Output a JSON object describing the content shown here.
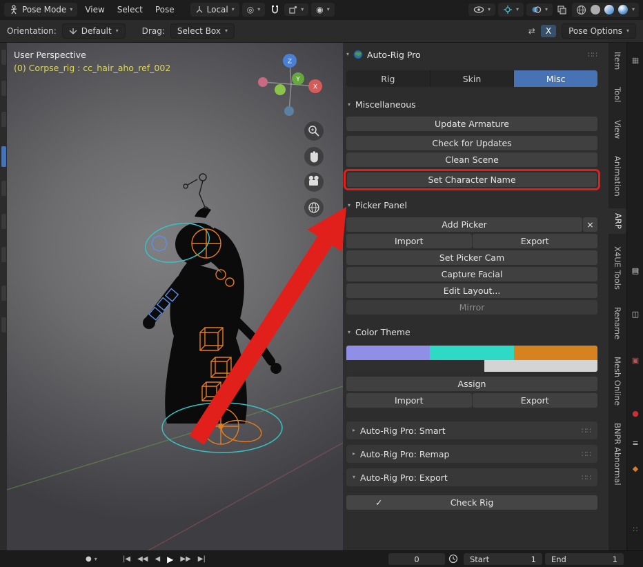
{
  "colors": {
    "accent_blue": "#4772b3",
    "highlight_red": "#e2201b",
    "swatch_lavender": "#8f8fe8",
    "swatch_turquoise": "#2ed9c5",
    "swatch_orange": "#d6821f",
    "swatch_dark": "#2f2f2f",
    "swatch_light": "#d4d4d4"
  },
  "icons": {
    "chevron_down": "▾",
    "chevron_right": "▸",
    "close": "×",
    "check": "✓",
    "grip": "∷∷",
    "record": "●",
    "pivot": "◎",
    "prop_edit": "◉",
    "mirror_axes": "⇄",
    "jump_start": "|◀",
    "prev_key": "◀◀",
    "play_back": "◀",
    "play": "▶",
    "next_key": "▶▶",
    "jump_end": "▶|"
  },
  "topbar": {
    "mode": "Pose Mode",
    "menus": [
      "View",
      "Select",
      "Pose"
    ],
    "orientation": "Local"
  },
  "toolbar": {
    "orientation_label": "Orientation:",
    "orientation_value": "Default",
    "drag_label": "Drag:",
    "drag_value": "Select Box",
    "mirror_x": "X",
    "pose_options": "Pose Options"
  },
  "viewport": {
    "view_label": "User Perspective",
    "object_label": "(0) Corpse_rig : cc_hair_aho_ref_002",
    "axis": {
      "x": "X",
      "y": "Y",
      "z": "Z"
    }
  },
  "panel": {
    "title": "Auto-Rig Pro",
    "tabs": [
      "Rig",
      "Skin",
      "Misc"
    ],
    "active_tab": "Misc",
    "sections": {
      "misc": "Miscellaneous",
      "picker": "Picker Panel",
      "color": "Color Theme"
    },
    "buttons": {
      "update_armature": "Update Armature",
      "check_updates": "Check for Updates",
      "clean_scene": "Clean Scene",
      "set_character_name": "Set Character Name",
      "add_picker": "Add Picker",
      "import": "Import",
      "export": "Export",
      "set_picker_cam": "Set Picker Cam",
      "capture_facial": "Capture Facial",
      "edit_layout": "Edit Layout...",
      "mirror": "Mirror",
      "assign": "Assign",
      "check_rig": "Check Rig"
    },
    "subpanels": {
      "smart": "Auto-Rig Pro: Smart",
      "remap": "Auto-Rig Pro: Remap",
      "export": "Auto-Rig Pro: Export"
    }
  },
  "side_tabs": [
    "Item",
    "Tool",
    "View",
    "Animation",
    "ARP",
    "X4UE Tools",
    "Rename",
    "Mesh Online",
    "BNPR Abnormal"
  ],
  "edge_icons": [
    {
      "glyph": "▦",
      "color": "#8a8a8a"
    },
    {
      "glyph": "▤",
      "color": "#d8d8d8"
    },
    {
      "glyph": "◫",
      "color": "#cccccc"
    },
    {
      "glyph": "▣",
      "color": "#c05050"
    },
    {
      "glyph": "●",
      "color": "#c83232"
    },
    {
      "glyph": "≡",
      "color": "#d0d0d0"
    },
    {
      "glyph": "◆",
      "color": "#d08030"
    },
    {
      "glyph": "∷",
      "color": "#5a9a4a"
    }
  ],
  "timeline": {
    "frame": "0",
    "start_label": "Start",
    "start_value": "1",
    "end_label": "End",
    "end_value": "1"
  }
}
